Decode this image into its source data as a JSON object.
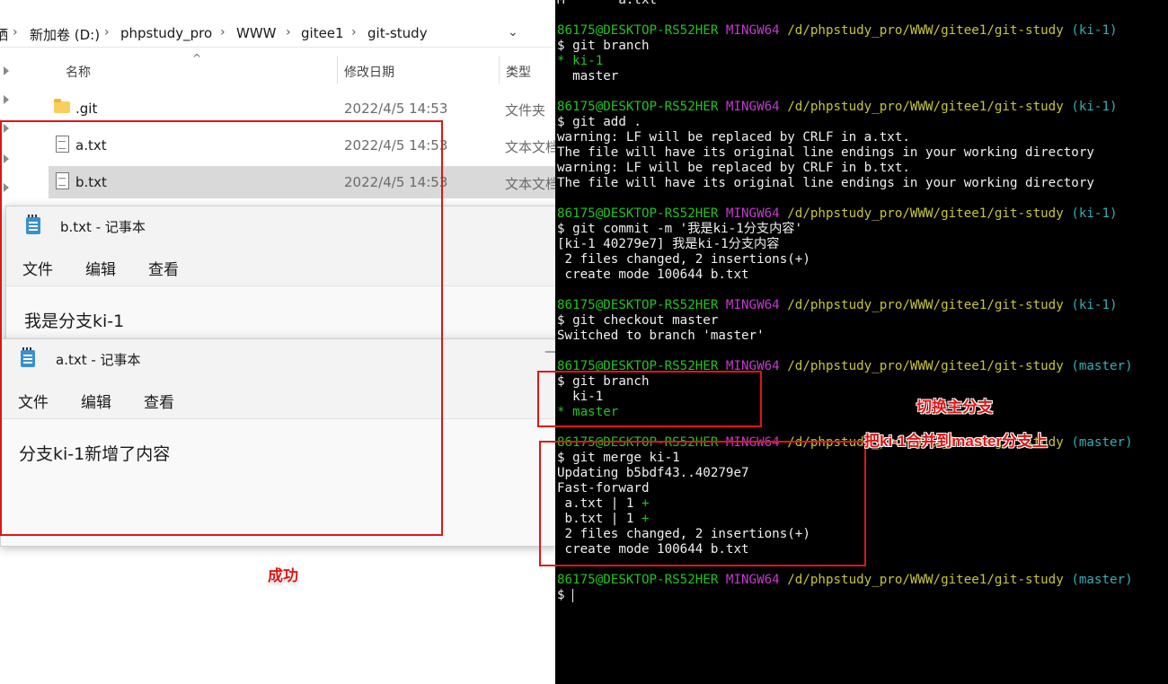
{
  "explorer": {
    "breadcrumbs": [
      "硒",
      "新加卷 (D:)",
      "phpstudy_pro",
      "WWW",
      "gitee1",
      "git-study"
    ],
    "columns": {
      "name": "名称",
      "modified": "修改日期",
      "type": "类型"
    },
    "files": [
      {
        "name": ".git",
        "date": "2022/4/5 14:53",
        "type": "文件夹",
        "icon": "folder-icon"
      },
      {
        "name": "a.txt",
        "date": "2022/4/5 14:53",
        "type": "文本文档",
        "icon": "text-file-icon"
      },
      {
        "name": "b.txt",
        "date": "2022/4/5 14:53",
        "type": "文本文档",
        "icon": "text-file-icon",
        "selected": true
      }
    ]
  },
  "notepad_b": {
    "title": "b.txt - 记事本",
    "menu": [
      "文件",
      "编辑",
      "查看"
    ],
    "content": "我是分支ki-1"
  },
  "notepad_a": {
    "title": "a.txt - 记事本",
    "menu": [
      "文件",
      "编辑",
      "查看"
    ],
    "content": "分支ki-1新增了内容",
    "minimize": "—"
  },
  "terminal": {
    "top_partial": "M       a.txt",
    "user": "86175@DESKTOP-RS52HER",
    "shell": "MINGW64",
    "path": "/d/phpstudy_pro/WWW/gitee1/git-study",
    "branch_ki": "(ki-1)",
    "branch_master": "(master)",
    "cmd_branch": "$ git branch",
    "out_branch1_cur": "* ki-1",
    "out_branch1_other": "  master",
    "cmd_add": "$ git add .",
    "warn1": "warning: LF will be replaced by CRLF in a.txt.",
    "warn_note": "The file will have its original line endings in your working directory",
    "warn2": "warning: LF will be replaced by CRLF in b.txt.",
    "cmd_commit": "$ git commit -m '我是ki-1分支内容'",
    "commit_out1": "[ki-1 40279e7] 我是ki-1分支内容",
    "commit_out2": " 2 files changed, 2 insertions(+)",
    "commit_out3": " create mode 100644 b.txt",
    "cmd_checkout": "$ git checkout master",
    "checkout_out": "Switched to branch 'master'",
    "out_branch2_other": "  ki-1",
    "out_branch2_cur": "* master",
    "cmd_merge": "$ git merge ki-1",
    "merge_out1": "Updating b5bdf43..40279e7",
    "merge_out2": "Fast-forward",
    "merge_a_file": " a.txt | 1 ",
    "merge_b_file": " b.txt | 1 ",
    "merge_plus": "+",
    "merge_out3": " 2 files changed, 2 insertions(+)",
    "merge_out4": " create mode 100644 b.txt",
    "prompt": "$ "
  },
  "annotations": {
    "switch_master": "切换主分支",
    "merge_note": "把ki-1合并到master分支上",
    "success": "成功"
  },
  "colors": {
    "annotation_red": "#e01515",
    "term_green": "#23c223",
    "term_magenta": "#c33ad0",
    "term_yellow": "#c7c43a",
    "term_cyan": "#34aeb8"
  }
}
